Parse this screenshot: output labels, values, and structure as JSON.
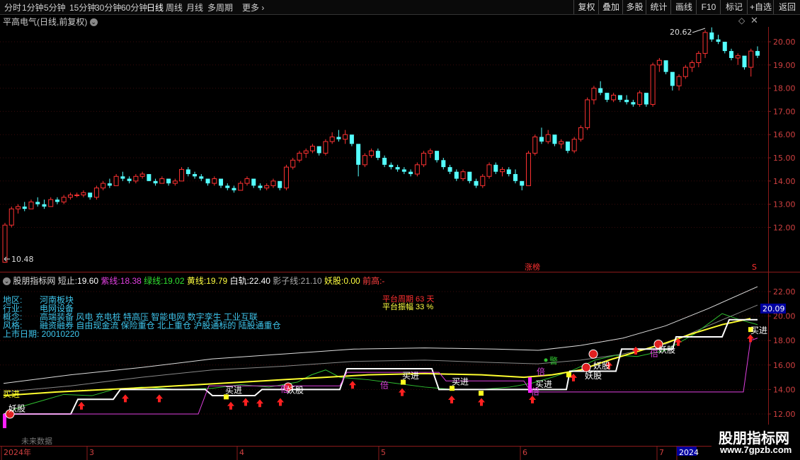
{
  "periods": [
    "分时",
    "1分钟",
    "5分钟",
    "15分钟",
    "30分钟",
    "60分钟",
    "日线",
    "周线",
    "月线",
    "多周期",
    "更多"
  ],
  "tools": [
    "复权",
    "叠加",
    "多股",
    "统计",
    "画线",
    "F10",
    "标记",
    "+自选",
    "返回"
  ],
  "main": {
    "title": "平高电气(日线,前复权)",
    "high_label": "20.62",
    "low_label": "10.48",
    "badge": "涨榜",
    "y_labels": [
      "20.00",
      "19.00",
      "18.00",
      "17.00",
      "16.00",
      "15.00",
      "14.00",
      "13.00",
      "12.00"
    ]
  },
  "indicator": {
    "name": "股朋指标网",
    "short_label": "短止:",
    "short_val": "19.60",
    "purple_label": "紫线:",
    "purple_val": "18.38",
    "green_label": "绿线:",
    "green_val": "19.02",
    "yellow_label": "黄线:",
    "yellow_val": "19.79",
    "white_label": "白轨:",
    "white_val": "22.40",
    "shadow_label": "影子线:",
    "shadow_val": "21.10",
    "yao_label": "妖股:",
    "yao_val": "0.00",
    "prev_label": "前高:",
    "prev_val": "-",
    "y_labels": [
      "22.00",
      "20.00",
      "18.00",
      "16.00",
      "14.00",
      "12.00"
    ],
    "current_val": "20.09",
    "platform_period": "平台周期 63 天",
    "platform_amp": "平台振幅 33 %"
  },
  "info": {
    "region_label": "地区:",
    "region": "河南板块",
    "industry_label": "行业:",
    "industry": "电网设备",
    "concept_label": "概念:",
    "concept": "高端装备 风电 充电桩 特高压 智能电网 数字孪生 工业互联",
    "style_label": "风格:",
    "style": "融资融券 自由现金流 保险重仓 北上重仓 沪股通标的 陆股通重仓",
    "list_date": "上市日期: 20010220"
  },
  "signals": {
    "buy": "买进",
    "yao": "妖股",
    "bei": "倍",
    "warn": "警",
    "future": "未来数据"
  },
  "xaxis": [
    "2024年",
    "3",
    "4",
    "5",
    "6",
    "7",
    "2024"
  ],
  "watermark": "股朋指标网",
  "watermark_url": "www.7gpzb.com",
  "chart_data": {
    "type": "candlestick",
    "ohlc": [
      [
        10.5,
        12.2,
        10.48,
        12.1
      ],
      [
        12.1,
        12.9,
        12.0,
        12.8
      ],
      [
        12.8,
        13.0,
        12.6,
        12.9
      ],
      [
        12.9,
        13.1,
        12.7,
        12.8
      ],
      [
        12.8,
        13.2,
        12.8,
        13.1
      ],
      [
        13.1,
        13.3,
        12.9,
        13.0
      ],
      [
        13.0,
        13.2,
        12.8,
        12.9
      ],
      [
        12.9,
        13.3,
        12.9,
        13.2
      ],
      [
        13.2,
        13.3,
        13.0,
        13.1
      ],
      [
        13.1,
        13.4,
        13.0,
        13.3
      ],
      [
        13.3,
        13.5,
        13.2,
        13.4
      ],
      [
        13.4,
        13.5,
        13.3,
        13.4
      ],
      [
        13.4,
        13.6,
        13.3,
        13.5
      ],
      [
        13.5,
        13.4,
        13.2,
        13.3
      ],
      [
        13.3,
        13.8,
        13.2,
        13.7
      ],
      [
        13.7,
        14.0,
        13.6,
        13.9
      ],
      [
        13.9,
        14.1,
        13.7,
        13.8
      ],
      [
        13.8,
        14.3,
        13.8,
        14.2
      ],
      [
        14.2,
        14.4,
        14.0,
        14.1
      ],
      [
        14.1,
        14.2,
        13.9,
        14.0
      ],
      [
        14.0,
        14.3,
        13.9,
        14.2
      ],
      [
        14.2,
        14.4,
        14.1,
        14.3
      ],
      [
        14.3,
        14.2,
        14.0,
        14.0
      ],
      [
        14.0,
        14.1,
        13.8,
        13.9
      ],
      [
        13.9,
        14.2,
        13.9,
        14.1
      ],
      [
        14.1,
        14.0,
        13.8,
        13.9
      ],
      [
        13.9,
        14.1,
        13.8,
        14.0
      ],
      [
        14.0,
        14.6,
        14.0,
        14.5
      ],
      [
        14.5,
        14.6,
        14.2,
        14.3
      ],
      [
        14.3,
        14.4,
        14.1,
        14.2
      ],
      [
        14.2,
        14.3,
        14.0,
        14.1
      ],
      [
        14.1,
        14.0,
        13.8,
        13.9
      ],
      [
        13.9,
        14.2,
        13.8,
        14.1
      ],
      [
        14.1,
        14.0,
        13.7,
        13.8
      ],
      [
        13.8,
        13.9,
        13.6,
        13.7
      ],
      [
        13.7,
        13.8,
        13.5,
        13.6
      ],
      [
        13.6,
        14.0,
        13.6,
        13.9
      ],
      [
        13.9,
        14.2,
        13.8,
        14.1
      ],
      [
        14.1,
        13.9,
        13.7,
        13.8
      ],
      [
        13.8,
        13.9,
        13.6,
        13.7
      ],
      [
        13.7,
        13.9,
        13.6,
        13.8
      ],
      [
        13.8,
        14.1,
        13.7,
        14.0
      ],
      [
        14.0,
        13.9,
        13.6,
        13.7
      ],
      [
        13.7,
        14.7,
        13.6,
        14.6
      ],
      [
        14.6,
        15.0,
        14.5,
        14.9
      ],
      [
        14.9,
        15.3,
        14.8,
        15.2
      ],
      [
        15.2,
        15.4,
        15.0,
        15.3
      ],
      [
        15.3,
        15.6,
        15.2,
        15.5
      ],
      [
        15.5,
        15.4,
        15.1,
        15.2
      ],
      [
        15.2,
        15.8,
        15.1,
        15.7
      ],
      [
        15.7,
        16.1,
        15.6,
        15.9
      ],
      [
        15.9,
        16.2,
        15.7,
        15.8
      ],
      [
        15.8,
        16.2,
        15.6,
        16.0
      ],
      [
        16.0,
        15.8,
        15.5,
        15.6
      ],
      [
        15.6,
        15.4,
        14.2,
        14.7
      ],
      [
        14.7,
        15.2,
        14.6,
        15.1
      ],
      [
        15.1,
        15.4,
        15.0,
        15.3
      ],
      [
        15.3,
        15.4,
        14.9,
        15.0
      ],
      [
        15.0,
        15.1,
        14.6,
        14.7
      ],
      [
        14.7,
        14.8,
        14.5,
        14.6
      ],
      [
        14.6,
        14.7,
        14.4,
        14.5
      ],
      [
        14.5,
        14.6,
        14.3,
        14.4
      ],
      [
        14.4,
        14.5,
        14.2,
        14.3
      ],
      [
        14.3,
        14.8,
        14.2,
        14.7
      ],
      [
        14.7,
        15.3,
        14.6,
        15.2
      ],
      [
        15.2,
        15.4,
        15.0,
        15.3
      ],
      [
        15.3,
        15.2,
        14.8,
        14.9
      ],
      [
        14.9,
        15.0,
        14.5,
        14.6
      ],
      [
        14.6,
        14.7,
        14.3,
        14.4
      ],
      [
        14.4,
        14.5,
        14.0,
        14.1
      ],
      [
        14.1,
        14.5,
        14.0,
        14.4
      ],
      [
        14.4,
        14.3,
        13.9,
        14.0
      ],
      [
        14.0,
        14.1,
        13.7,
        13.8
      ],
      [
        13.8,
        14.3,
        13.7,
        14.2
      ],
      [
        14.2,
        14.8,
        14.1,
        14.7
      ],
      [
        14.7,
        14.8,
        14.3,
        14.4
      ],
      [
        14.4,
        14.6,
        14.2,
        14.5
      ],
      [
        14.5,
        14.6,
        14.2,
        14.3
      ],
      [
        14.3,
        14.5,
        13.9,
        14.0
      ],
      [
        14.0,
        13.9,
        13.6,
        13.8
      ],
      [
        13.8,
        15.3,
        13.8,
        15.2
      ],
      [
        15.2,
        16.0,
        15.1,
        15.9
      ],
      [
        15.9,
        16.3,
        15.6,
        15.7
      ],
      [
        15.7,
        16.2,
        15.6,
        16.0
      ],
      [
        16.0,
        15.9,
        15.5,
        15.6
      ],
      [
        15.6,
        15.8,
        15.4,
        15.7
      ],
      [
        15.7,
        15.6,
        15.2,
        15.3
      ],
      [
        15.3,
        15.9,
        15.2,
        15.8
      ],
      [
        15.8,
        16.4,
        15.7,
        16.3
      ],
      [
        16.3,
        17.6,
        16.2,
        17.5
      ],
      [
        17.5,
        18.1,
        17.3,
        18.0
      ],
      [
        18.0,
        18.3,
        17.7,
        17.8
      ],
      [
        17.8,
        17.7,
        17.4,
        17.5
      ],
      [
        17.5,
        17.8,
        17.4,
        17.7
      ],
      [
        17.7,
        17.6,
        17.4,
        17.5
      ],
      [
        17.5,
        17.7,
        17.3,
        17.4
      ],
      [
        17.4,
        17.5,
        17.2,
        17.3
      ],
      [
        17.3,
        17.9,
        17.2,
        17.8
      ],
      [
        17.8,
        17.6,
        17.2,
        17.3
      ],
      [
        17.3,
        19.1,
        17.2,
        19.0
      ],
      [
        19.0,
        19.3,
        18.7,
        19.2
      ],
      [
        19.2,
        19.1,
        18.6,
        18.7
      ],
      [
        18.7,
        18.5,
        17.9,
        18.1
      ],
      [
        18.1,
        18.6,
        17.9,
        18.5
      ],
      [
        18.5,
        19.0,
        18.4,
        18.9
      ],
      [
        18.9,
        19.2,
        18.7,
        19.1
      ],
      [
        19.1,
        19.6,
        18.9,
        19.5
      ],
      [
        19.5,
        20.5,
        19.3,
        20.4
      ],
      [
        20.4,
        20.62,
        20.0,
        20.1
      ],
      [
        20.1,
        20.3,
        19.9,
        20.0
      ],
      [
        20.0,
        19.9,
        19.5,
        19.6
      ],
      [
        19.6,
        19.7,
        19.2,
        19.3
      ],
      [
        19.3,
        19.5,
        19.0,
        19.4
      ],
      [
        19.4,
        19.3,
        18.8,
        18.9
      ],
      [
        18.9,
        19.7,
        18.5,
        19.6
      ],
      [
        19.6,
        19.8,
        19.3,
        19.4
      ]
    ]
  }
}
